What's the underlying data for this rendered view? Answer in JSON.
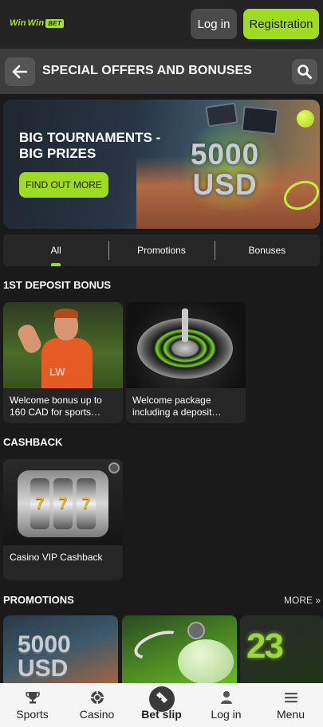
{
  "header": {
    "logo": {
      "part1": "Win",
      "part2": "Win",
      "badge": "BET"
    },
    "login_label": "Log in",
    "register_label": "Registration"
  },
  "page": {
    "title": "SPECIAL OFFERS AND BONUSES"
  },
  "hero": {
    "title": "BIG TOURNAMENTS - BIG PRIZES",
    "button_label": "FIND OUT MORE",
    "amount": "5000",
    "currency": "USD"
  },
  "tabs": [
    {
      "label": "All",
      "active": true
    },
    {
      "label": "Promotions",
      "active": false
    },
    {
      "label": "Bonuses",
      "active": false
    }
  ],
  "sections": {
    "deposit": {
      "title": "1ST DEPOSIT BONUS",
      "cards": [
        {
          "caption": "Welcome bonus up to 160 CAD for sports…",
          "logo": "LW"
        },
        {
          "caption": "Welcome package including a deposit…"
        }
      ]
    },
    "cashback": {
      "title": "CASHBACK",
      "cards": [
        {
          "caption": "Casino VIP Cashback",
          "reels": [
            "7",
            "7",
            "7"
          ]
        }
      ]
    },
    "promotions": {
      "title": "PROMOTIONS",
      "more_label": "MORE",
      "tiles": [
        {
          "amount": "5000",
          "currency": "USD"
        },
        {
          "name": "piggy-bank"
        },
        {
          "digits": "23"
        }
      ]
    }
  },
  "bottom_nav": [
    {
      "label": "Sports",
      "icon": "trophy-icon"
    },
    {
      "label": "Casino",
      "icon": "casino-chip-icon"
    },
    {
      "label": "Bet slip",
      "icon": "ticket-icon"
    },
    {
      "label": "Log in",
      "icon": "user-icon"
    },
    {
      "label": "Menu",
      "icon": "hamburger-icon"
    }
  ],
  "colors": {
    "accent": "#9fdc21",
    "background": "#1a1a1a",
    "surface": "#262626",
    "header": "#3d3d3d",
    "nav_background": "#f5f5f5"
  }
}
